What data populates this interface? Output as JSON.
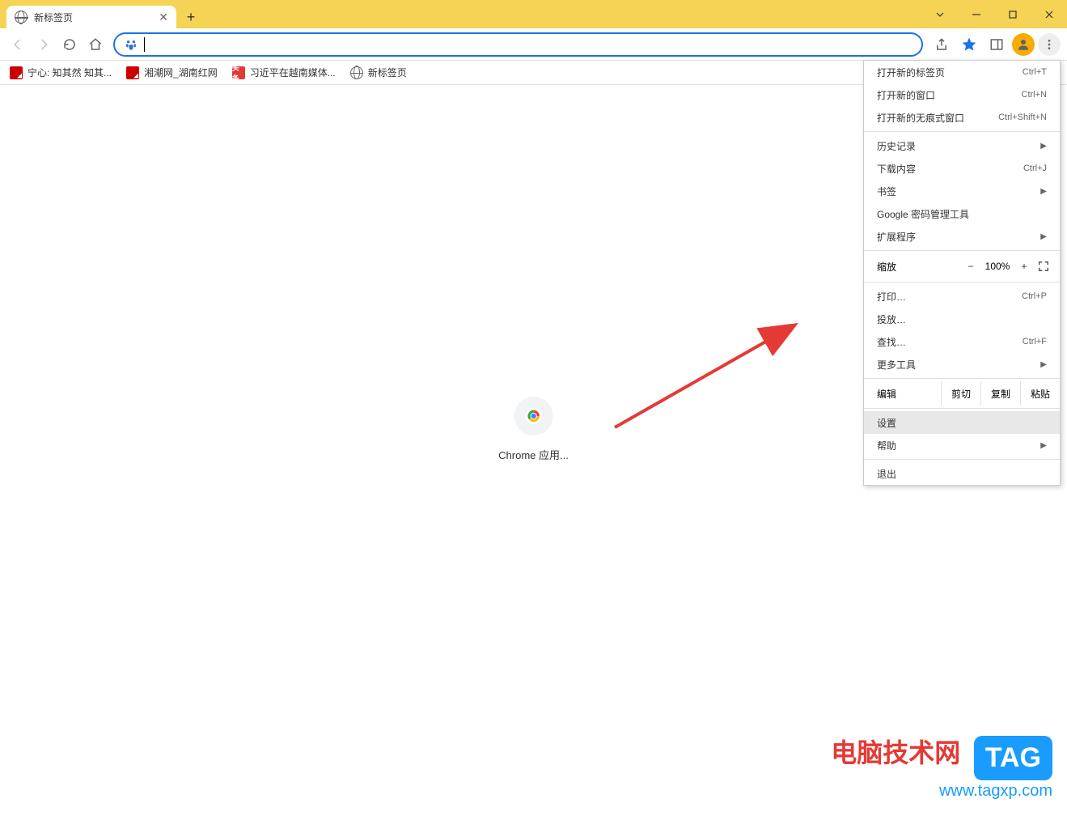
{
  "tab": {
    "title": "新标签页"
  },
  "bookmarks": [
    {
      "label": "宁心: 知其然 知其..."
    },
    {
      "label": "湘潮网_湖南红网"
    },
    {
      "label": "习近平在越南媒体...",
      "badge": "头条"
    },
    {
      "label": "新标签页"
    }
  ],
  "content": {
    "shortcut_label": "Chrome 应用..."
  },
  "menu": {
    "new_tab": {
      "label": "打开新的标签页",
      "shortcut": "Ctrl+T"
    },
    "new_window": {
      "label": "打开新的窗口",
      "shortcut": "Ctrl+N"
    },
    "new_incognito": {
      "label": "打开新的无痕式窗口",
      "shortcut": "Ctrl+Shift+N"
    },
    "history": {
      "label": "历史记录"
    },
    "downloads": {
      "label": "下载内容",
      "shortcut": "Ctrl+J"
    },
    "bookmarks": {
      "label": "书签"
    },
    "password_manager": {
      "label": "Google 密码管理工具"
    },
    "extensions": {
      "label": "扩展程序"
    },
    "zoom": {
      "label": "缩放",
      "value": "100%",
      "minus": "−",
      "plus": "+"
    },
    "print": {
      "label": "打印…",
      "shortcut": "Ctrl+P"
    },
    "cast": {
      "label": "投放…"
    },
    "find": {
      "label": "查找…",
      "shortcut": "Ctrl+F"
    },
    "more_tools": {
      "label": "更多工具"
    },
    "edit": {
      "label": "编辑",
      "cut": "剪切",
      "copy": "复制",
      "paste": "粘贴"
    },
    "settings": {
      "label": "设置"
    },
    "help": {
      "label": "帮助"
    },
    "exit": {
      "label": "退出"
    }
  },
  "watermark": {
    "title": "电脑技术网",
    "tag": "TAG",
    "url": "www.tagxp.com"
  }
}
